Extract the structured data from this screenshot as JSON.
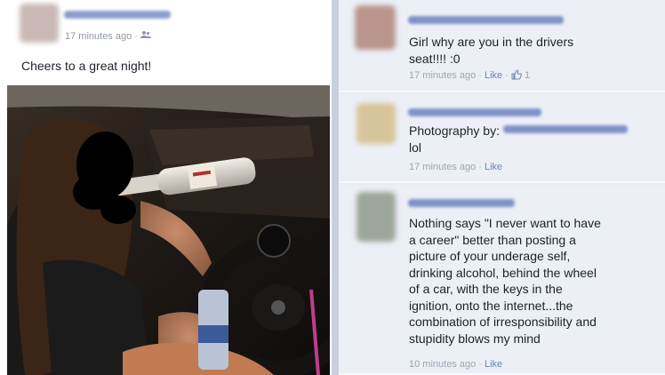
{
  "post": {
    "time": "17 minutes ago ·",
    "audience_icon": "friends-icon",
    "text": "Cheers to a great night!"
  },
  "comments": [
    {
      "text_line1": "Girl why are you in the drivers",
      "text_line2": "seat!!!! :0",
      "time": "17 minutes ago · ",
      "like": "Like",
      "sep": " · ",
      "likes_count": "1",
      "like_icon": "thumbs-up-icon"
    },
    {
      "text_line1": "Photography by:",
      "text_line2": "lol",
      "time": "17 minutes ago · ",
      "like": "Like"
    },
    {
      "lines": [
        "Nothing says \"I never want to have",
        "a career\" better than posting a",
        "picture of your underage self,",
        "drinking alcohol, behind the wheel",
        "of a car, with the keys in the",
        "ignition, onto the internet...the",
        "combination of irresponsibility and",
        "stupidity blows my mind"
      ],
      "time": "10 minutes ago · ",
      "like": "Like"
    }
  ],
  "colors": {
    "link": "#4b67a1",
    "meta": "#9197a3",
    "panel": "#eceff6"
  }
}
